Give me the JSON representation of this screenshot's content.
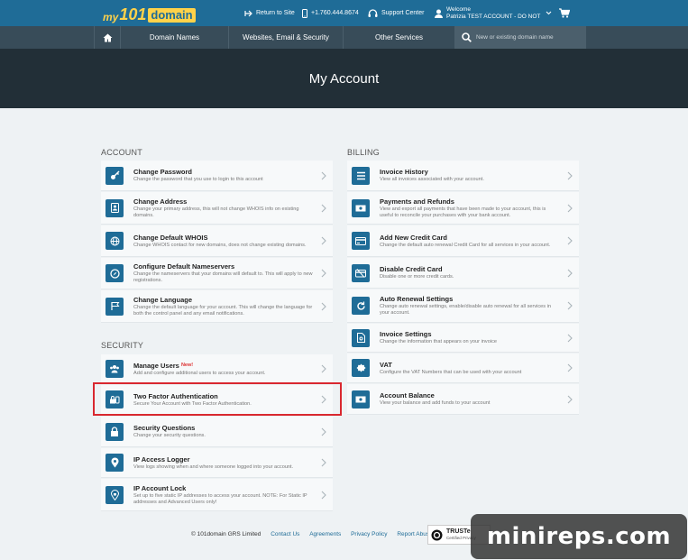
{
  "topbar": {
    "logo_my": "my",
    "logo_num": "101",
    "logo_domain": "domain",
    "return_label": "Return to Site",
    "phone": "+1.760.444.8674",
    "support_label": "Support Center",
    "welcome_label": "Welcome",
    "user_name": "Patrizia TEST ACCOUNT - DO NOT"
  },
  "nav": {
    "items": [
      "Domain Names",
      "Websites, Email & Security",
      "Other Services"
    ],
    "search_placeholder": "New or existing domain name"
  },
  "hero": {
    "title": "My Account"
  },
  "account": {
    "section_title": "ACCOUNT",
    "items": [
      {
        "title": "Change Password",
        "desc": "Change the password that you use to login to this account",
        "icon": "key-icon"
      },
      {
        "title": "Change Address",
        "desc": "Change your primary address, this will not change WHOIS info on existing domains.",
        "icon": "address-card-icon"
      },
      {
        "title": "Change Default WHOIS",
        "desc": "Change WHOIS contact for new domains, does not change existing domains.",
        "icon": "globe-icon"
      },
      {
        "title": "Configure Default Nameservers",
        "desc": "Change the nameservers that your domains will default to. This will apply to new registrations.",
        "icon": "compass-icon"
      },
      {
        "title": "Change Language",
        "desc": "Change the default language for your account. This will change the language for both the control panel and any email notifications.",
        "icon": "flag-icon"
      }
    ]
  },
  "security": {
    "section_title": "SECURITY",
    "items": [
      {
        "title": "Manage Users",
        "badge": "New!",
        "desc": "Add and configure additional users to access your account.",
        "icon": "users-icon"
      },
      {
        "title": "Two Factor Authentication",
        "desc": "Secure Your Account with Two Factor Authentication.",
        "icon": "two-factor-icon"
      },
      {
        "title": "Security Questions",
        "desc": "Change your security questions.",
        "icon": "lock-icon"
      },
      {
        "title": "IP Access Logger",
        "desc": "View logs showing when and where someone logged into your account.",
        "icon": "map-pin-icon"
      },
      {
        "title": "IP Account Lock",
        "desc": "Set up to five static IP addresses to access your account. NOTE: For Static IP addresses and Advanced Users only!",
        "icon": "ip-lock-icon"
      }
    ]
  },
  "billing": {
    "section_title": "BILLING",
    "items": [
      {
        "title": "Invoice History",
        "desc": "View all invoices associated with your account.",
        "icon": "list-icon"
      },
      {
        "title": "Payments and Refunds",
        "desc": "View and export all payments that have been made to your account, this is useful to reconcile your purchases with your bank account.",
        "icon": "money-icon"
      },
      {
        "title": "Add New Credit Card",
        "desc": "Change the default auto renewal Credit Card for all services in your account.",
        "icon": "credit-card-icon"
      },
      {
        "title": "Disable Credit Card",
        "desc": "Disable one or more credit cards.",
        "icon": "disable-card-icon"
      },
      {
        "title": "Auto Renewal Settings",
        "desc": "Change auto renewal settings, enable/disable auto renewal for all services in your account.",
        "icon": "renew-icon"
      },
      {
        "title": "Invoice Settings",
        "desc": "Change the information that appears on your invoice",
        "icon": "invoice-icon"
      },
      {
        "title": "VAT",
        "desc": "Configure the VAT Numbers that can be used with your account",
        "icon": "vat-badge-icon"
      },
      {
        "title": "Account Balance",
        "desc": "View your balance and add funds to your account",
        "icon": "wallet-icon"
      }
    ]
  },
  "footer": {
    "copyright": "© 101domain GRS Limited",
    "links": [
      "Contact Us",
      "Agreements",
      "Privacy Policy",
      "Report Abuse"
    ],
    "truste_title": "TRUSTe",
    "truste_sub": "Certified Privacy"
  },
  "watermark": "minireps.com",
  "colors": {
    "accent": "#1f6c97",
    "nav": "#384c59",
    "hero": "#222f37",
    "highlight": "#d9282f"
  }
}
